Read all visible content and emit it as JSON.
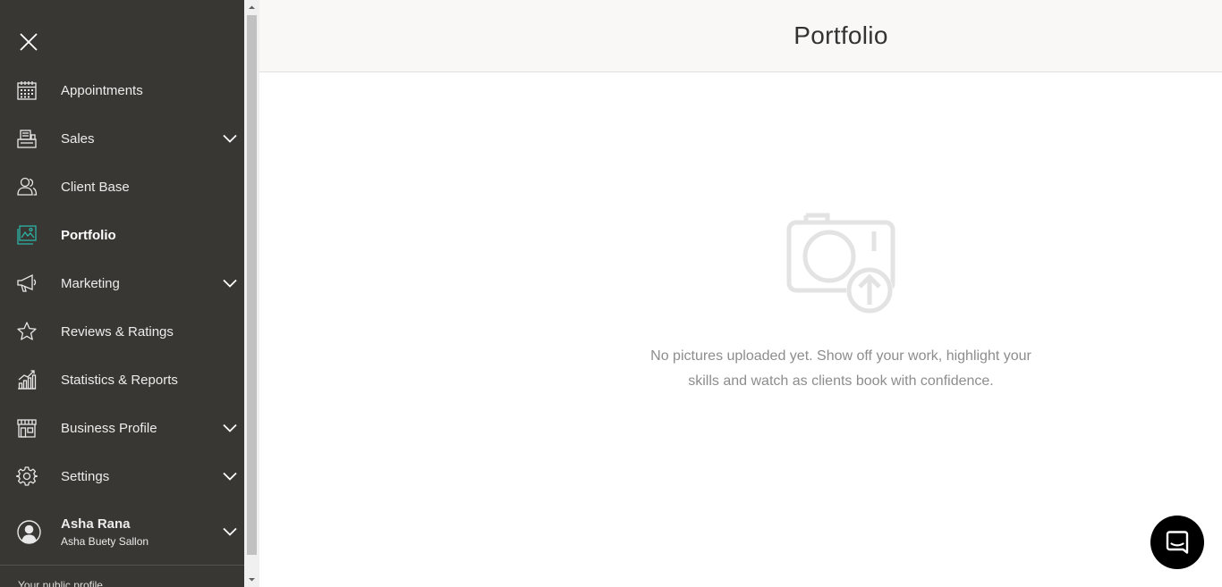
{
  "sidebar": {
    "close_icon": "close-icon",
    "items": [
      {
        "label": "Appointments",
        "icon": "calendar-icon",
        "expandable": false,
        "active": false
      },
      {
        "label": "Sales",
        "icon": "cash-register-icon",
        "expandable": true,
        "active": false
      },
      {
        "label": "Client Base",
        "icon": "clients-icon",
        "expandable": false,
        "active": false
      },
      {
        "label": "Portfolio",
        "icon": "portfolio-icon",
        "expandable": false,
        "active": true
      },
      {
        "label": "Marketing",
        "icon": "megaphone-icon",
        "expandable": true,
        "active": false
      },
      {
        "label": "Reviews & Ratings",
        "icon": "star-icon",
        "expandable": false,
        "active": false
      },
      {
        "label": "Statistics & Reports",
        "icon": "chart-icon",
        "expandable": false,
        "active": false
      },
      {
        "label": "Business Profile",
        "icon": "storefront-icon",
        "expandable": true,
        "active": false
      },
      {
        "label": "Settings",
        "icon": "gear-icon",
        "expandable": true,
        "active": false
      }
    ],
    "user": {
      "name": "Asha Rana",
      "salon": "Asha Buety Sallon",
      "icon": "user-avatar-icon"
    },
    "public_profile_label": "Your public profile"
  },
  "header": {
    "title": "Portfolio"
  },
  "main": {
    "empty_icon": "camera-upload-icon",
    "empty_line1": "No pictures uploaded yet. Show off your work, highlight your",
    "empty_line2": "skills and watch as clients book with confidence."
  },
  "chat": {
    "icon": "chat-bubble-icon"
  },
  "colors": {
    "sidebar_bg": "#393733",
    "active_icon": "#2ab3a6",
    "header_bg": "#f9f8f7",
    "empty_text": "#8d8d8d",
    "chat_bg": "#000000"
  }
}
